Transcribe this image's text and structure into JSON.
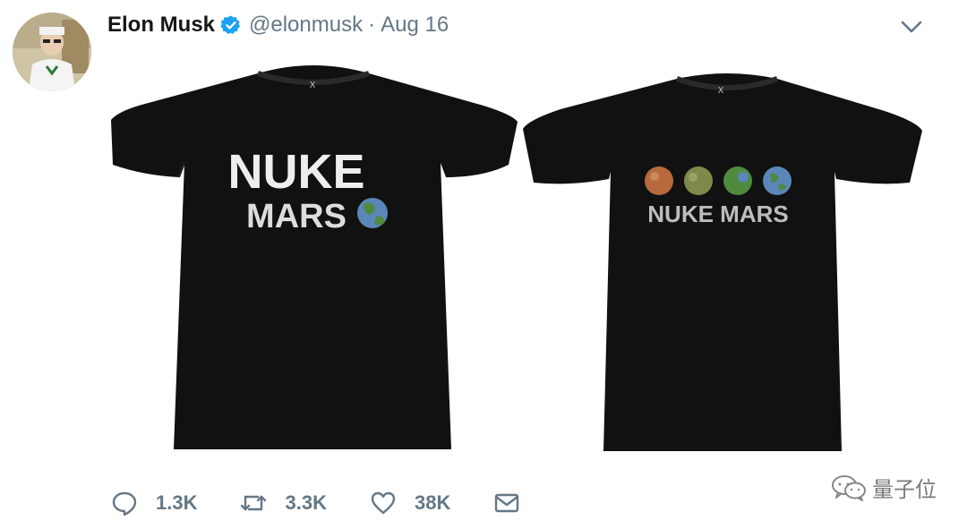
{
  "tweet": {
    "author_name": "Elon Musk",
    "handle": "@elonmusk",
    "separator": "·",
    "date": "Aug 16"
  },
  "icons": {
    "verified": "verified-badge-icon",
    "more": "chevron-down-icon",
    "reply": "reply-icon",
    "retweet": "retweet-icon",
    "like": "heart-icon",
    "dm": "envelope-icon",
    "watermark": "wechat-icon"
  },
  "colors": {
    "verified_blue": "#1da1f2",
    "meta_gray": "#657786",
    "shirt_black": "#111111"
  },
  "media": {
    "shirt_left": {
      "line1": "NUKE",
      "line2": "MARS",
      "brand_mark": "X"
    },
    "shirt_right": {
      "line1": "NUKE MARS",
      "brand_mark": "X"
    }
  },
  "actions": {
    "replies": "1.3K",
    "retweets": "3.3K",
    "likes": "38K"
  },
  "watermark": {
    "text": "量子位"
  }
}
